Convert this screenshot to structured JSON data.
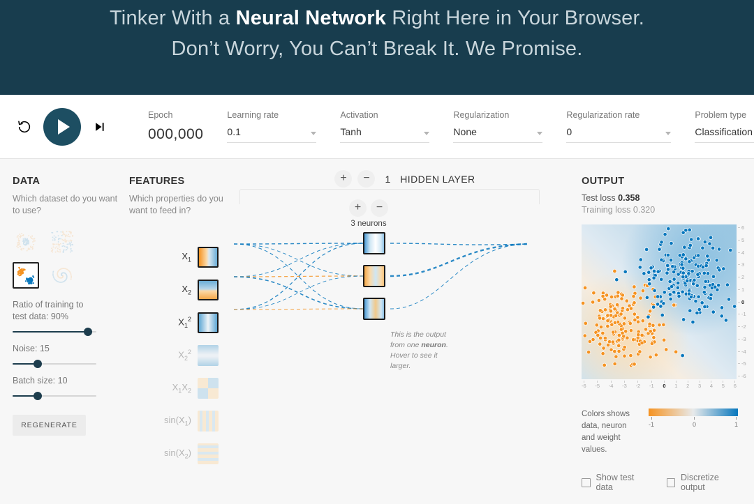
{
  "header": {
    "line1_pre": "Tinker With a ",
    "line1_bold": "Neural Network",
    "line1_post": " Right Here in Your Browser.",
    "line2": "Don’t Worry, You Can’t Break It. We Promise."
  },
  "controls": {
    "reset_icon": "restart-icon",
    "play_icon": "play-icon",
    "step_icon": "step-forward-icon",
    "epoch_label": "Epoch",
    "epoch_value": "000,000",
    "learning_rate_label": "Learning rate",
    "learning_rate_value": "0.1",
    "activation_label": "Activation",
    "activation_value": "Tanh",
    "regularization_label": "Regularization",
    "regularization_value": "None",
    "regularization_rate_label": "Regularization rate",
    "regularization_rate_value": "0",
    "problem_type_label": "Problem type",
    "problem_type_value": "Classification"
  },
  "data_panel": {
    "title": "DATA",
    "subtitle": "Which dataset do you want to use?",
    "datasets": [
      {
        "name": "circle",
        "selected": false
      },
      {
        "name": "exclusive-or",
        "selected": false
      },
      {
        "name": "gaussian",
        "selected": true
      },
      {
        "name": "spiral",
        "selected": false
      }
    ],
    "ratio_label": "Ratio of training to test data:",
    "ratio_value": "90%",
    "ratio_pct": 90,
    "noise_label": "Noise:",
    "noise_value": "15",
    "noise_pct": 30,
    "batch_label": "Batch size:",
    "batch_value": "10",
    "batch_pct": 30,
    "regenerate_label": "REGENERATE"
  },
  "features_panel": {
    "title": "FEATURES",
    "subtitle": "Which properties do you want to feed in?",
    "items": [
      {
        "label_html": "X<sub>1</sub>",
        "name": "feature-x1",
        "active": true,
        "thumb": "x1"
      },
      {
        "label_html": "X<sub>2</sub>",
        "name": "feature-x2",
        "active": true,
        "thumb": "x2"
      },
      {
        "label_html": "X<sub>1</sub><sup>2</sup>",
        "name": "feature-x1-squared",
        "active": true,
        "thumb": "x1sq"
      },
      {
        "label_html": "X<sub>2</sub><sup>2</sup>",
        "name": "feature-x2-squared",
        "active": false,
        "thumb": "x2sq"
      },
      {
        "label_html": "X<sub>1</sub>X<sub>2</sub>",
        "name": "feature-x1x2",
        "active": false,
        "thumb": "x1x2"
      },
      {
        "label_html": "sin(X<sub>1</sub>)",
        "name": "feature-sin-x1",
        "active": false,
        "thumb": "sinx1"
      },
      {
        "label_html": "sin(X<sub>2</sub>)",
        "name": "feature-sin-x2",
        "active": false,
        "thumb": "sinx2"
      }
    ]
  },
  "network_panel": {
    "add_layer_label": "+",
    "remove_layer_label": "−",
    "layer_count": "1",
    "layer_title": "HIDDEN LAYER",
    "add_neuron_label": "+",
    "remove_neuron_label": "−",
    "neuron_count_label": "3 neurons",
    "callout_pre": "This is the output from one ",
    "callout_bold": "neuron",
    "callout_post": ". Hover to see it larger."
  },
  "output_panel": {
    "title": "OUTPUT",
    "test_loss_label": "Test loss",
    "test_loss_value": "0.358",
    "training_loss_label": "Training loss",
    "training_loss_value": "0.320",
    "x_ticks": [
      "-6",
      "-5",
      "-4",
      "-3",
      "-2",
      "-1",
      "0",
      "1",
      "2",
      "3",
      "4",
      "5",
      "6"
    ],
    "y_ticks": [
      "6",
      "5",
      "4",
      "3",
      "2",
      "1",
      "0",
      "-1",
      "-2",
      "-3",
      "-4",
      "-5",
      "-6"
    ],
    "legend_text": "Colors shows data, neuron and weight values.",
    "gradient_ticks": [
      "-1",
      "0",
      "1"
    ],
    "show_test_data_label": "Show test data",
    "discretize_output_label": "Discretize output",
    "show_test_data_checked": false,
    "discretize_output_checked": false
  },
  "colors": {
    "header_bg": "#183d4e",
    "accent": "#1d4e62",
    "positive": "#0877bd",
    "negative": "#f59322",
    "neutral": "#e8eaeb"
  },
  "chart_data": {
    "type": "scatter",
    "title": "OUTPUT",
    "xlabel": "",
    "ylabel": "",
    "xlim": [
      -6,
      6
    ],
    "ylim": [
      -6,
      6
    ],
    "grid": true,
    "legend": "Colors shows data, neuron and weight values.",
    "series": [
      {
        "name": "class-negative",
        "color": "#f59322",
        "approx_center": [
          -2.6,
          -1.6
        ],
        "approx_spread": 1.6,
        "count": 170
      },
      {
        "name": "class-positive",
        "color": "#0877bd",
        "approx_center": [
          2.3,
          2.0
        ],
        "approx_spread": 1.7,
        "count": 180
      }
    ],
    "background": "decision-boundary-heatmap",
    "test_loss": 0.358,
    "training_loss": 0.32
  }
}
